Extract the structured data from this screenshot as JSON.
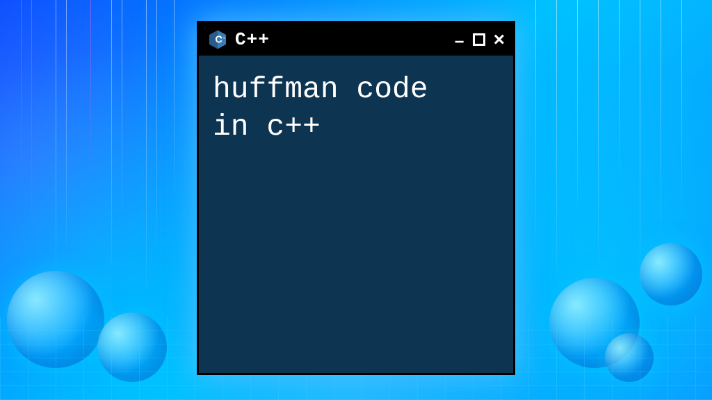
{
  "window": {
    "title": "C++",
    "content_line1": "huffman code",
    "content_line2": "in c++"
  },
  "controls": {
    "minimize": "−",
    "close": "×"
  }
}
